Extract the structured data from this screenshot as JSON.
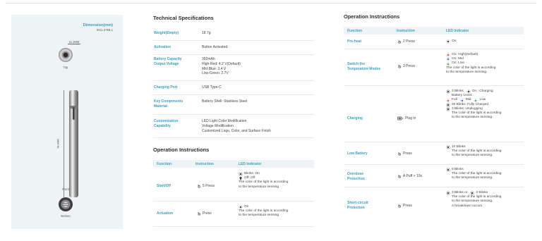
{
  "product": {
    "dimension_title": "Dimension(mm)",
    "dimension_value": "Φ11.2*98.1",
    "diameter_label": "11.2MM",
    "length_label": "98.1MM",
    "view_top": "Top",
    "view_front": "Front",
    "view_bottom": "Bottom"
  },
  "tech_specs": {
    "title": "Technical Specifications",
    "rows": [
      {
        "label": "Weight(Empty)",
        "value": "18.7g"
      },
      {
        "label": "Activation",
        "value": "Button Activated"
      },
      {
        "label_1": "Battery Capacity",
        "label_2": "Output Voltage",
        "value_1": "350mAh",
        "value_2": "High-Red: 4.2 V(Default)",
        "value_3": "Mid-Blue: 3.4 V",
        "value_4": "Low-Green: 2.7V"
      },
      {
        "label": "Charging Port",
        "value": "USB Type-C"
      },
      {
        "label_1": "Key Components",
        "label_2": "Material",
        "value": "Battery Shell: Stainless Steel"
      },
      {
        "label_1": "Customization",
        "label_2": "Capability",
        "value_1": "LED Light Color Modification",
        "value_2": "Voltage Modification",
        "value_3": "Customized Logo, Color, and Surface Finish"
      }
    ]
  },
  "op_left": {
    "title": "Operation Instructions",
    "headers": [
      "Function",
      "Instruction",
      "LED Indicator"
    ],
    "rows": [
      {
        "function": "Start/Off",
        "instruction": "5 Press",
        "led_1": "Blinks: On",
        "led_2": "Off: Off",
        "led_3": "The color of the light is according",
        "led_4": "to the temperature sensing."
      },
      {
        "function": "Actuation",
        "instruction": "Press",
        "led_1": "On",
        "led_2": "The color of the light is according",
        "led_3": "to the temperature sensing."
      }
    ]
  },
  "op_right": {
    "title": "Operation Instructions",
    "headers": [
      "Function",
      "Instruction",
      "LED Indicator"
    ],
    "rows": [
      {
        "function": "Pre-heat",
        "instruction": "2 Press",
        "led_1": "On"
      },
      {
        "function_1": "Switch the",
        "function_2": "Temperature Modes",
        "instruction": "3 Press",
        "led_1": "On: High(Default)",
        "led_2": "On: Mid",
        "led_3": "On: Low",
        "led_4": "The color of the light is according",
        "led_5": "to the temperature sensing."
      },
      {
        "function": "Charging",
        "instruction": "Plug in",
        "led_1a": "3 Blinks",
        "led_1b": "On : Charging",
        "led_2": "Battery Level:",
        "led_3a": "Full",
        "led_3b": "Mid",
        "led_3c": "Low",
        "led_4": "20 Blinks: Fully Charged",
        "led_5": "3 Blinks: Unplugging",
        "led_6": "The color of the light is according",
        "led_7": "to the temperature sensing."
      },
      {
        "function": "Low Battery",
        "instruction": "Press",
        "led_1": "10 Blinks",
        "led_2": "The color of the light is according",
        "led_3": "to the temperature sensing."
      },
      {
        "function_1": "Overdose",
        "function_2": "Protection",
        "instruction": "A Puff > 10s",
        "led_1": "5 Blinks",
        "led_2": "The color of the light is according",
        "led_3": "to the temperature sensing."
      },
      {
        "function_1": "Short-circuit",
        "function_2": "Protection",
        "instruction": "Press",
        "led_1a": "3 Blinks or",
        "led_1b": "3 Blinks",
        "led_2": "The color of the light is according",
        "led_3": "to the temperature sensing.",
        "led_4": "A breakdown occurs."
      }
    ]
  },
  "colors": {
    "accent": "#3aa0c0",
    "panel": "#eef4f6",
    "led_red": "#d94b2b",
    "led_blue": "#2f6fd0",
    "led_green": "#3aa84a",
    "led_dark": "#2a2a2a"
  },
  "icons": [
    "hand-press-icon",
    "plug-icon",
    "sun-blink-icon"
  ]
}
